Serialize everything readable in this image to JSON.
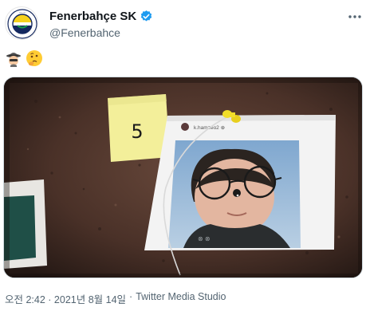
{
  "tweet": {
    "author": {
      "display_name": "Fenerbahçe SK",
      "handle": "@Fenerbahce",
      "verified": true
    },
    "text_emojis": [
      "detective-emoji",
      "thinking-face-emoji"
    ],
    "media": {
      "note_number": "5",
      "photo_caption": "k.hamzeo2 ⊕"
    },
    "timestamp": "오전 2:42 · 2021년 8월 14일",
    "separator": "·",
    "source": "Twitter Media Studio"
  },
  "colors": {
    "accent_blue": "#1d9bf0",
    "secondary_text": "#536471",
    "cork": "#3b2822",
    "sticky_note": "#f3ef9a"
  },
  "icons": [
    "verified-icon",
    "more-icon"
  ]
}
